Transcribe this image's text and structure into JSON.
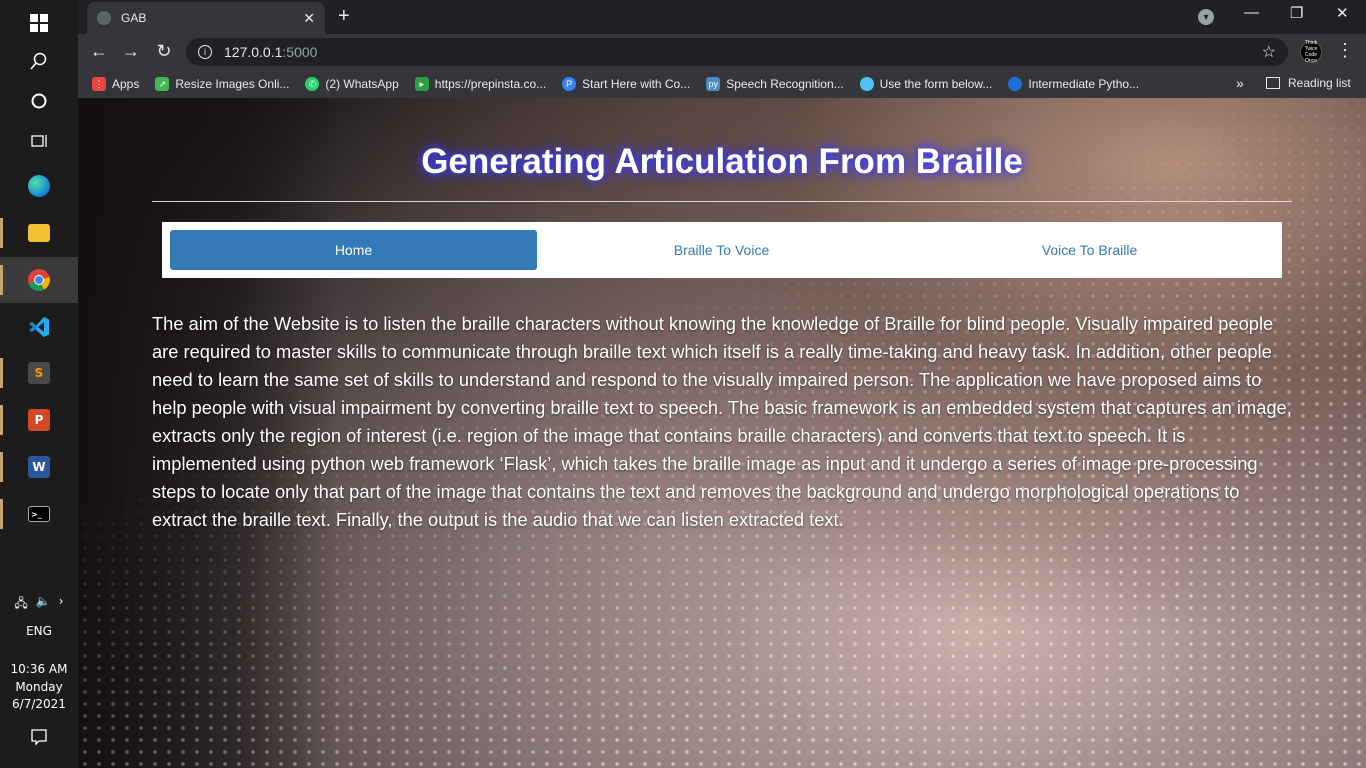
{
  "taskbar": {
    "lang": "ENG",
    "time": "10:36 AM",
    "day": "Monday",
    "date": "6/7/2021"
  },
  "browser": {
    "tab_title": "GAB",
    "url_host": "127.0.0.1",
    "url_port": ":5000",
    "bookmarks": [
      {
        "label": "Apps",
        "color": "#e8453c",
        "icon": "apps-grid-icon"
      },
      {
        "label": "Resize Images Onli...",
        "color": "#3fb950",
        "icon": "resize-icon"
      },
      {
        "label": "(2) WhatsApp",
        "color": "#25d366",
        "icon": "whatsapp-icon"
      },
      {
        "label": "https://prepinsta.co...",
        "color": "#2e9e44",
        "icon": "prepinsta-icon"
      },
      {
        "label": "Start Here with Co...",
        "color": "#3b82f6",
        "icon": "p-icon"
      },
      {
        "label": "Speech Recognition...",
        "color": "#4b8bbe",
        "icon": "python-icon"
      },
      {
        "label": "Use the form below...",
        "color": "#4fc3f7",
        "icon": "form-icon"
      },
      {
        "label": "Intermediate Pytho...",
        "color": "#1e6fd9",
        "icon": "bookmark-icon"
      }
    ],
    "reading_list": "Reading list",
    "avatar_text": "Think Twice Code Once"
  },
  "page": {
    "title": "Generating Articulation From Braille",
    "nav": [
      {
        "label": "Home",
        "active": true
      },
      {
        "label": "Braille To Voice",
        "active": false
      },
      {
        "label": "Voice To Braille",
        "active": false
      }
    ],
    "about": "The aim of the Website is to listen the braille characters without knowing the knowledge of Braille for blind people. Visually impaired people are required to master skills to communicate through braille text which itself is a really time-taking and heavy task. In addition, other people need to learn the same set of skills to understand and respond to the visually impaired person. The application we have proposed aims to help people with visual impairment by converting braille text to speech. The basic framework is an embedded system that captures an image, extracts only the region of interest (i.e. region of the image that contains braille characters) and converts that text to speech. It is implemented using python web framework ‘Flask’, which takes the braille image as input and it undergo a series of image pre-processing steps to locate only that part of the image that contains the text and removes the background and undergo morphological operations to extract the braille text. Finally, the output is the audio that we can listen extracted text."
  }
}
